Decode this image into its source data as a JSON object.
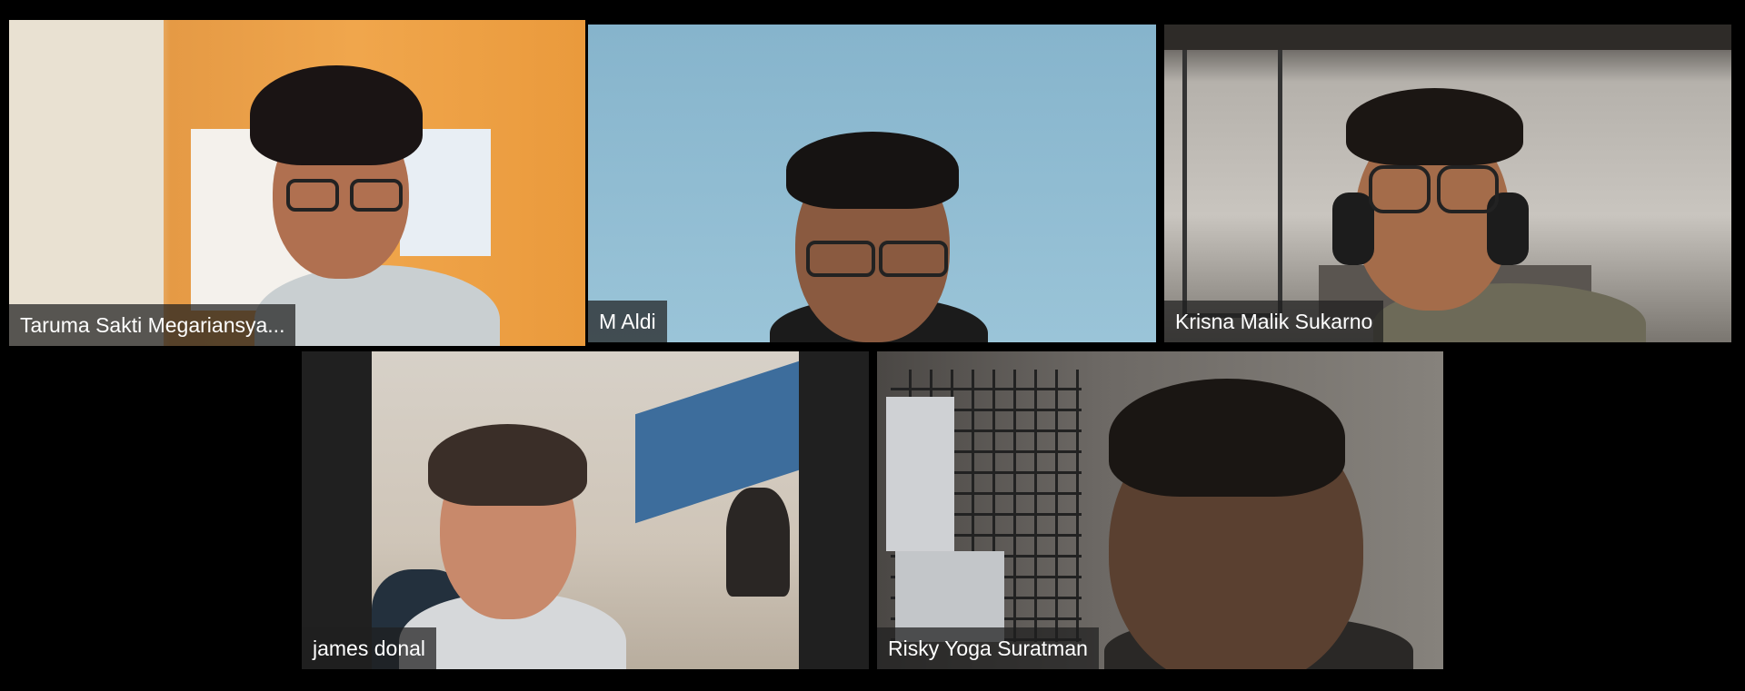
{
  "meeting": {
    "active_speaker_color": "#64e02a",
    "participants": [
      {
        "name": "Taruma Sakti Megariansya...",
        "active_speaker": true,
        "video_icon": "participant-video"
      },
      {
        "name": "M Aldi",
        "active_speaker": false,
        "video_icon": "participant-video"
      },
      {
        "name": "Krisna Malik Sukarno",
        "active_speaker": false,
        "video_icon": "participant-video"
      },
      {
        "name": "james donal",
        "active_speaker": false,
        "video_icon": "participant-video"
      },
      {
        "name": "Risky Yoga Suratman",
        "active_speaker": false,
        "video_icon": "participant-video"
      }
    ]
  }
}
